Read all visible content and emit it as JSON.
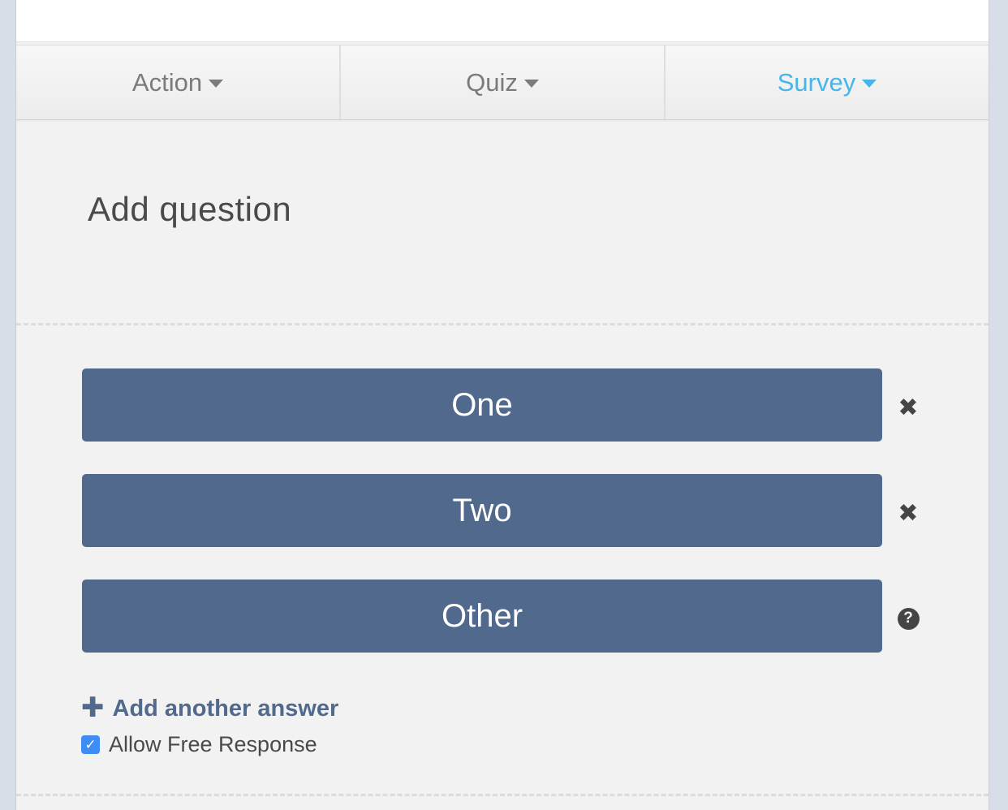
{
  "tabs": [
    {
      "label": "Action",
      "active": false
    },
    {
      "label": "Quiz",
      "active": false
    },
    {
      "label": "Survey",
      "active": true
    }
  ],
  "question": {
    "title": "Add question"
  },
  "answers": [
    {
      "label": "One",
      "icon": "remove-icon"
    },
    {
      "label": "Two",
      "icon": "remove-icon"
    },
    {
      "label": "Other",
      "icon": "help-icon"
    }
  ],
  "add_answer_label": "Add another answer",
  "free_response": {
    "label": "Allow Free Response",
    "checked": true
  },
  "colors": {
    "answer_bg": "#51698c",
    "active_tab": "#46b6ea",
    "checkbox": "#3d8df5"
  }
}
